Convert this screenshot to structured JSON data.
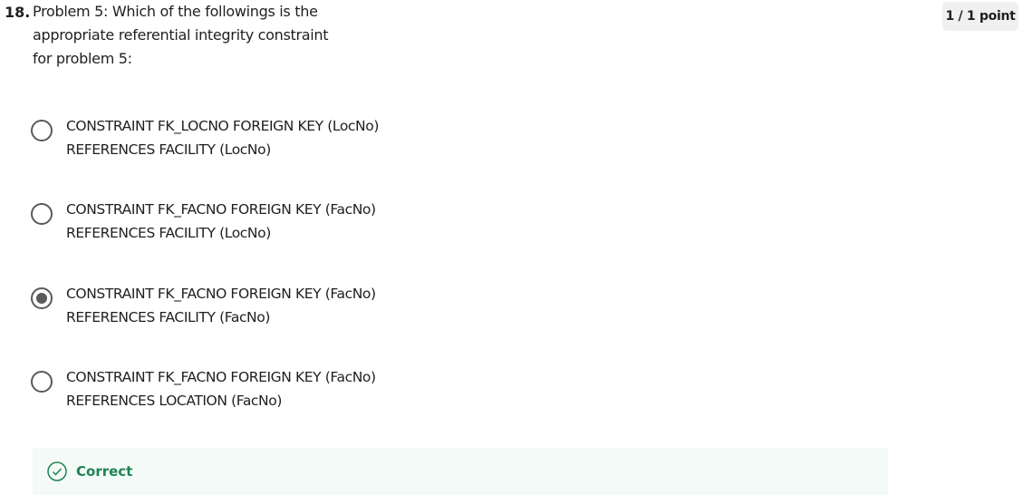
{
  "question": {
    "number": "18.",
    "text": "Problem 5: Which of the followings is the appropriate referential integrity constraint for problem 5:",
    "points": "1 / 1 point"
  },
  "options": [
    {
      "line1": "CONSTRAINT FK_LOCNO FOREIGN KEY (LocNo)",
      "line2": "REFERENCES FACILITY (LocNo)",
      "selected": false
    },
    {
      "line1": "CONSTRAINT FK_FACNO FOREIGN KEY (FacNo)",
      "line2": "REFERENCES FACILITY (LocNo)",
      "selected": false
    },
    {
      "line1": "CONSTRAINT FK_FACNO FOREIGN KEY (FacNo)",
      "line2": "REFERENCES FACILITY (FacNo)",
      "selected": true
    },
    {
      "line1": "CONSTRAINT FK_FACNO FOREIGN KEY (FacNo)",
      "line2": "REFERENCES LOCATION (FacNo)",
      "selected": false
    }
  ],
  "feedback": {
    "label": "Correct",
    "icon": "check-circle-icon",
    "color": "#1f8354",
    "background": "#f4faf7"
  }
}
